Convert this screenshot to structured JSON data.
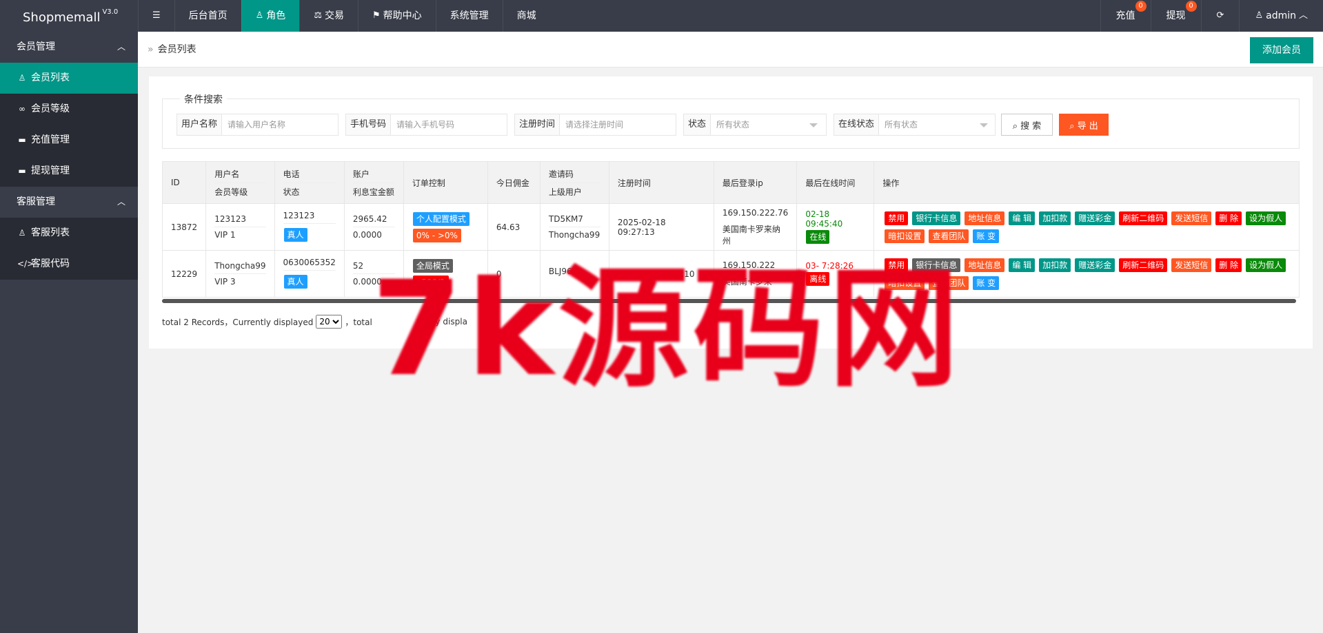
{
  "app": {
    "name": "Shopmemall",
    "version": "V3.0"
  },
  "topnav": {
    "items": [
      {
        "label": "后台首页",
        "icon": ""
      },
      {
        "label": "角色",
        "icon": "user-icon",
        "active": true
      },
      {
        "label": "交易",
        "icon": "scale-icon"
      },
      {
        "label": "帮助中心",
        "icon": "flag-icon"
      },
      {
        "label": "系统管理",
        "icon": ""
      },
      {
        "label": "商城",
        "icon": ""
      }
    ],
    "right": {
      "recharge": {
        "label": "充值",
        "badge": "0"
      },
      "withdraw": {
        "label": "提现",
        "badge": "0"
      },
      "refresh_icon": "refresh-icon",
      "user": "admin"
    }
  },
  "sidebar": {
    "groups": [
      {
        "label": "会员管理",
        "items": [
          "会员列表",
          "会员等级",
          "充值管理",
          "提现管理"
        ]
      },
      {
        "label": "客服管理",
        "items": [
          "客服列表",
          "客服代码"
        ]
      }
    ]
  },
  "breadcrumb": {
    "sep": "»",
    "current": "会员列表"
  },
  "add_button": "添加会员",
  "search": {
    "legend": "条件搜索",
    "username": {
      "label": "用户名称",
      "placeholder": "请输入用户名称"
    },
    "phone": {
      "label": "手机号码",
      "placeholder": "请输入手机号码"
    },
    "regtime": {
      "label": "注册时间",
      "placeholder": "请选择注册时间"
    },
    "status": {
      "label": "状态",
      "value": "所有状态"
    },
    "online": {
      "label": "在线状态",
      "value": "所有状态"
    },
    "search_btn": "搜 索",
    "export_btn": "导 出"
  },
  "table": {
    "headers": {
      "id": "ID",
      "user": [
        "用户名",
        "会员等级"
      ],
      "phone": [
        "电话",
        "状态"
      ],
      "account": [
        "账户",
        "利息宝金额"
      ],
      "order": "订单控制",
      "commission": "今日佣金",
      "invite": [
        "邀请码",
        "上级用户"
      ],
      "regtime": "注册时间",
      "ip": "最后登录ip",
      "lastonline": "最后在线时间",
      "ops": "操作"
    },
    "rows": [
      {
        "id": "13872",
        "username": "123123",
        "level": "VIP 1",
        "phone": "123123",
        "status": "真人",
        "balance": "2965.42",
        "interest": "0.0000",
        "order_tags": [
          "个人配置模式",
          "0% - >0%"
        ],
        "commission": "64.63",
        "invite": "TD5KM7",
        "parent": "Thongcha99",
        "regtime": "2025-02-18 09:27:13",
        "ip": "169.150.222.76",
        "ip_loc": "美国南卡罗来纳州",
        "lastonline": "02-18 09:45:40",
        "online": "在线"
      },
      {
        "id": "12229",
        "username": "Thongcha99",
        "level": "VIP 3",
        "phone": "0630065352",
        "status": "真人",
        "balance": "52",
        "interest": "0.0000",
        "order_tags": [
          "全局模式",
          "a500/1"
        ],
        "commission": "0",
        "invite": "BLJ96T",
        "parent": "",
        "regtime": "2024-  20 21:21:10",
        "ip": "169.150.222",
        "ip_loc": "美国南卡罗来",
        "lastonline": "03-  7:28:26",
        "online": "离线"
      }
    ],
    "ops_row1": [
      "禁用",
      "银行卡信息",
      "地址信息",
      "编 辑",
      "加扣款",
      "赠送彩金",
      "刷新二维码",
      "发送短信",
      "删 除",
      "设为假人"
    ],
    "ops_row2": [
      "暗扣设置",
      "查看团队",
      "账 变"
    ]
  },
  "pager": {
    "total": "total 2 Records，Currently displayed",
    "size": "20",
    "suffix": "，total",
    "tail": "rently displa"
  },
  "watermark": "7k源码网"
}
